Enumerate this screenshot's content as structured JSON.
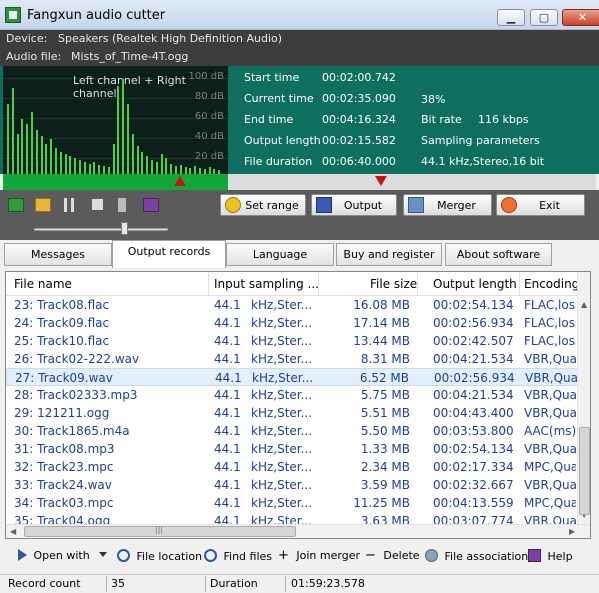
{
  "window": {
    "title": "Fangxun audio cutter",
    "minimize": "▁",
    "maximize": "▢",
    "close": "✕"
  },
  "info": {
    "device_label": "Device:",
    "device_value": "Speakers (Realtek High Definition Audio)",
    "file_label": "Audio file:",
    "file_value": "Mists_of_Time-4T.ogg"
  },
  "visualizer": {
    "caption": "Left channel + Right channel",
    "db_ticks": [
      "100 dB",
      "80 dB",
      "60 dB",
      "40 dB",
      "20 dB"
    ]
  },
  "display": {
    "start_label": "Start time",
    "start_value": "00:02:00.742",
    "current_label": "Current time",
    "current_value": "00:02:35.090",
    "current_pct": "38%",
    "end_label": "End time",
    "end_value": "00:04:16.324",
    "bitrate_label": "Bit rate",
    "bitrate_value": "116 kbps",
    "outlen_label": "Output length",
    "outlen_value": "00:02:15.582",
    "params_label": "Sampling parameters",
    "duration_label": "File duration",
    "duration_value": "00:06:40.000",
    "params_value": "44.1  kHz,Stereo,16 bit"
  },
  "range": {
    "start_fraction": 0.3,
    "current_fraction": 0.39
  },
  "toolbar": {
    "volume_fraction": 0.65,
    "set_range": "Set range",
    "output": "Output",
    "merger": "Merger",
    "exit": "Exit"
  },
  "tabs": [
    "Messages",
    "Output records",
    "Language",
    "Buy and register",
    "About software"
  ],
  "table": {
    "columns": [
      "File name",
      "Input sampling ...",
      "File size",
      "Output length",
      "Encoding"
    ],
    "rows": [
      [
        "23: Track08.flac",
        "44.1",
        "kHz,Ster...",
        "16.08 MB",
        "00:02:54.134",
        "FLAC,loss"
      ],
      [
        "24: Track09.flac",
        "44.1",
        "kHz,Ster...",
        "17.14 MB",
        "00:02:56.934",
        "FLAC,loss"
      ],
      [
        "25: Track10.flac",
        "44.1",
        "kHz,Ster...",
        "13.44 MB",
        "00:02:42.507",
        "FLAC,loss"
      ],
      [
        "26: Track02-222.wav",
        "44.1",
        "kHz,Ster...",
        "8.31 MB",
        "00:04:21.534",
        "VBR,Qual"
      ],
      [
        "27: Track09.wav",
        "44.1",
        "kHz,Ster...",
        "6.52 MB",
        "00:02:56.934",
        "VBR,Qual"
      ],
      [
        "28: Track02333.mp3",
        "44.1",
        "kHz,Ster...",
        "5.75 MB",
        "00:04:21.534",
        "VBR,Qual"
      ],
      [
        "29: 121211.ogg",
        "44.1",
        "kHz,Ster...",
        "5.51 MB",
        "00:04:43.400",
        "VBR,Qual"
      ],
      [
        "30: Track1865.m4a",
        "44.1",
        "kHz,Ster...",
        "5.50 MB",
        "00:03:53.800",
        "AAC(ms),"
      ],
      [
        "31: Track08.mp3",
        "44.1",
        "kHz,Ster...",
        "1.33 MB",
        "00:02:54.134",
        "VBR,Qual"
      ],
      [
        "32: Track23.mpc",
        "44.1",
        "kHz,Ster...",
        "2.34 MB",
        "00:02:17.334",
        "MPC,Qual"
      ],
      [
        "33: Track24.wav",
        "44.1",
        "kHz,Ster...",
        "3.59 MB",
        "00:02:32.667",
        "VBR,Qual"
      ],
      [
        "34: Track03.mpc",
        "44.1",
        "kHz,Ster...",
        "11.25 MB",
        "00:04:13.559",
        "MPC,Qual"
      ],
      [
        "35: Track04.ogg",
        "44.1",
        "kHz,Ster...",
        "3.63 MB",
        "00:03:07.774",
        "VBR,Qual"
      ]
    ],
    "selected_index": 4,
    "hscroll_grip": "|||"
  },
  "bottom": {
    "open_with": "Open with",
    "file_location": "File location",
    "find_files": "Find files",
    "join_merger": "Join merger",
    "delete": "Delete",
    "file_association": "File association",
    "help": "Help"
  },
  "status": {
    "count_label": "Record count",
    "count_value": "35",
    "duration_label": "Duration",
    "duration_value": "01:59:23.578"
  },
  "colors": {
    "row_text": "#1a3fa0",
    "display_bg": "#0f6f5f",
    "range_green": "#11a83a",
    "marker_red": "#d01010"
  }
}
